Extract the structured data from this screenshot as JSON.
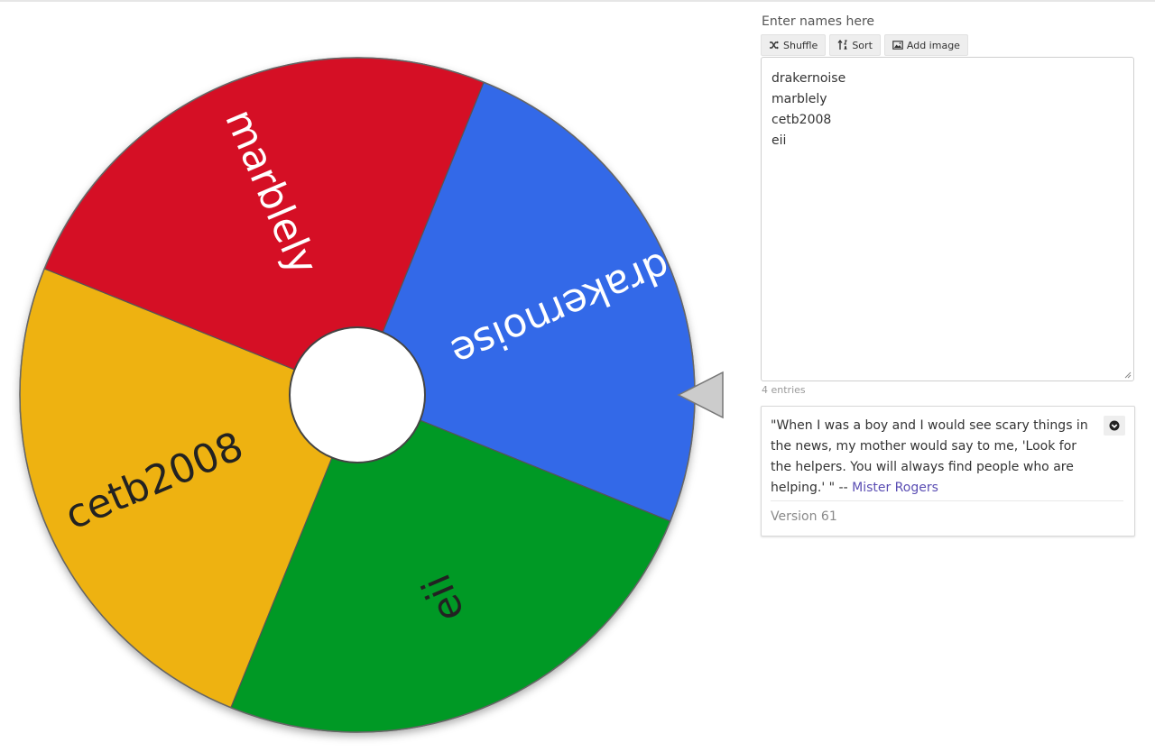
{
  "wheel": {
    "segments": [
      {
        "label": "drakernoise",
        "color": "#3369e8"
      },
      {
        "label": "eii",
        "color": "#009925"
      },
      {
        "label": "cetb2008",
        "color": "#eeb211"
      },
      {
        "label": "marblely",
        "color": "#d50f25"
      }
    ],
    "text_colors": [
      "#ffffff",
      "#222222",
      "#222222",
      "#ffffff"
    ],
    "rim_color": "#666666",
    "hub_color": "#ffffff",
    "pointer_color": "#cccccc"
  },
  "panel": {
    "heading": "Enter names here",
    "toolbar": {
      "shuffle_label": "Shuffle",
      "sort_label": "Sort",
      "add_image_label": "Add image"
    },
    "names": [
      "drakernoise",
      "marblely",
      "cetb2008",
      "eii"
    ],
    "entries_count": "4 entries"
  },
  "quote": {
    "text": "\"When I was a boy and I would see scary things in the news, my mother would say to me, 'Look for the helpers. You will always find people who are helping.' \" --",
    "author": "Mister Rogers",
    "author_color": "#5a4db3"
  },
  "version": "Version 61"
}
